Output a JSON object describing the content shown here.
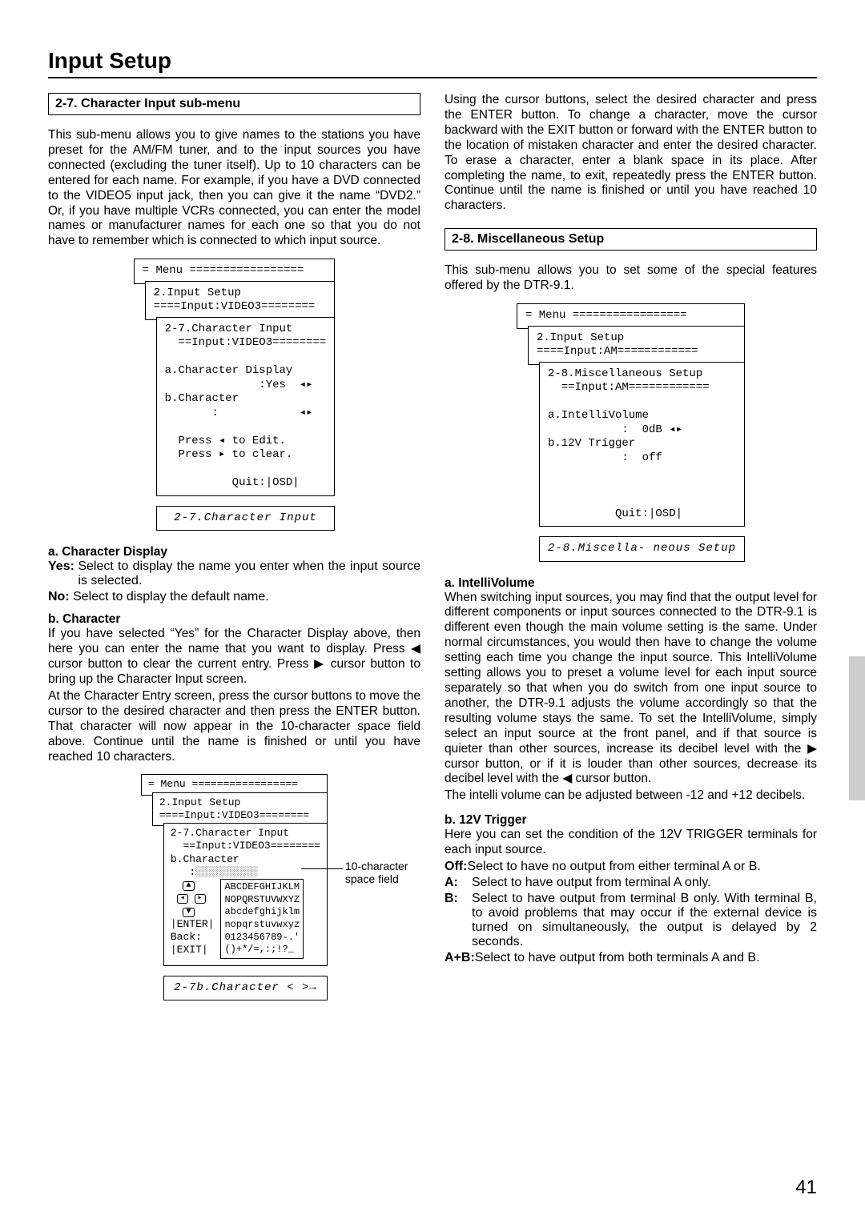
{
  "page_title": "Input Setup",
  "page_number": "41",
  "left": {
    "sec27_heading": "2-7. Character Input sub-menu",
    "sec27_intro": "This sub-menu allows you to give names to the stations you have preset for the AM/FM tuner, and to the input sources you have connected (excluding the tuner itself). Up to 10 characters can be entered for each name. For example, if you have a DVD connected to the VIDEO5 input jack, then you can give it the name “DVD2.” Or, if you have multiple VCRs connected, you can enter the model names or manufacturer names for each one so that you do not have to remember which is connected to which input source.",
    "osd1": {
      "menu": "= Menu =================",
      "l1a": "2.Input Setup",
      "l1b": "====Input:VIDEO3========",
      "l2a": "2-7.Character Input",
      "l2b": "  ==Input:VIDEO3========",
      "l3a": "a.Character Display",
      "l3b": "              :Yes  ◂▸",
      "l3c": "b.Character",
      "l3d": "       :            ◂▸",
      "l3e": "  Press ◂ to Edit.",
      "l3f": "  Press ▸ to clear.",
      "l3g": "          Quit:|OSD|",
      "panel_label": "2-7.Character\n        Input"
    },
    "a_charDisplay_head": "a. Character Display",
    "a_yes_label": "Yes: ",
    "a_yes_body": "Select to display the name you enter when the input source is selected.",
    "a_no_label": "No: ",
    "a_no_body": "Select to display the default name.",
    "b_char_head": "b. Character",
    "b_char_p1": "If you have selected “Yes” for the Character Display above, then here you can enter the name that you want to display. Press ◀ cursor button to clear the current entry. Press ▶ cursor button to bring up the Character Input screen.",
    "b_char_p2": "At the Character Entry screen, press the cursor buttons to move the cursor to the desired character and then press the ENTER button. That character will now appear in the 10-character space field above. Continue until the name is finished or until you have reached 10 characters.",
    "osd2": {
      "menu": "= Menu =================",
      "l1a": "2.Input Setup",
      "l1b": "====Input:VIDEO3========",
      "l2a": "2-7.Character Input",
      "l2b": "  ==Input:VIDEO3========",
      "l2c": "b.Character",
      "field": "   :░░░░░░░░░░",
      "nav1": " ▲",
      "nav2": "◂  ▸",
      "nav3": " ▼",
      "nav4": "|ENTER|",
      "nav5": "Back:",
      "nav6": "|EXIT|",
      "grid1": "ABCDEFGHIJKLM",
      "grid2": "NOPQRSTUVWXYZ",
      "grid3": "abcdefghijklm",
      "grid4": "nopqrstuvwxyz",
      "grid5": "0123456789-.'",
      "grid6": "()+*/=,:;!?_",
      "panel_label": "2-7b.Character\n<          >→",
      "callout": "10-character\nspace field"
    }
  },
  "right": {
    "cont_para": "Using the cursor buttons, select the desired character and press the ENTER button. To change a character, move the cursor backward with the EXIT button or forward with the ENTER button to the location of mistaken character and enter the desired character. To erase a character, enter a blank space in its place. After completing the name, to exit, repeatedly press the ENTER button. Continue until the name is finished or until you have reached 10 characters.",
    "sec28_heading": "2-8. Miscellaneous Setup",
    "sec28_intro": "This sub-menu allows you to set some of the special features offered by the DTR-9.1.",
    "osd3": {
      "menu": "= Menu =================",
      "l1a": "2.Input Setup",
      "l1b": "====Input:AM============",
      "l2a": "2-8.Miscellaneous Setup",
      "l2b": "  ==Input:AM============",
      "l3a": "a.IntelliVolume",
      "l3b": "           :  0dB ◂▸",
      "l3c": "b.12V Trigger",
      "l3d": "           :  off",
      "l3g": "          Quit:|OSD|",
      "panel_label": "2-8.Miscella-\n   neous Setup"
    },
    "a_iv_head": "a. IntelliVolume",
    "a_iv_p1": "When switching input sources, you may find that the output level for different components or input sources connected to the DTR-9.1 is different even though the main volume setting is the same. Under normal circumstances, you would then have to change the volume setting each time you change the input source. This IntelliVolume setting allows you to preset a volume level for each input source separately so that when you do switch from one input source to another, the DTR-9.1 adjusts the volume accordingly so that the resulting volume stays the same. To set the IntelliVolume, simply select an input source at the front panel, and if that source is quieter than other sources, increase its decibel level with the ▶ cursor button, or if it is louder than other sources, decrease its decibel level with the ◀ cursor button.",
    "a_iv_p2": "The intelli volume can be adjusted between -12 and +12 decibels.",
    "b_12v_head": "b. 12V Trigger",
    "b_12v_p": "Here you can set the condition of the 12V TRIGGER terminals for each input source.",
    "off_label": "Off:",
    "off_body": "Select to have no output from either terminal A or B.",
    "A_label": "A: ",
    "A_body": "Select to have output from terminal A only.",
    "B_label": "B: ",
    "B_body": "Select to have output from terminal B only. With terminal B, to avoid problems that may occur if the external device is turned on simultaneously, the output is delayed by 2 seconds.",
    "AB_label": "A+B:",
    "AB_body": "Select to have output from both terminals A and B."
  }
}
